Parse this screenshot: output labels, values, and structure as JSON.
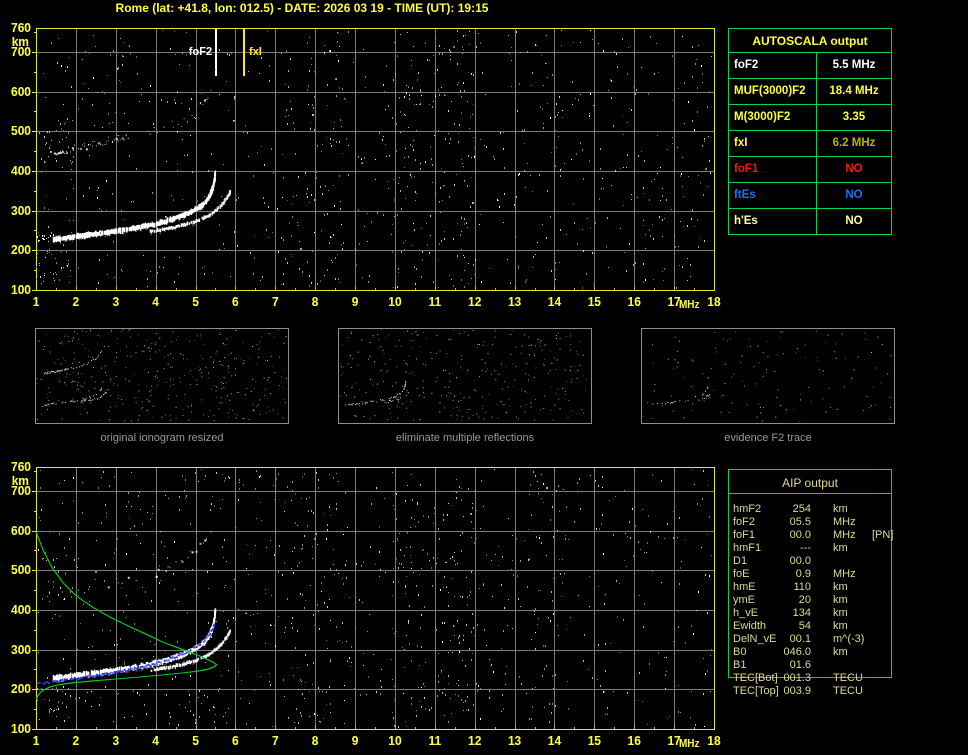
{
  "title": "Rome (lat: +41.8, lon: 012.5) - DATE: 2026 03 19 - TIME (UT): 19:15",
  "colors": {
    "background": "#000000",
    "title": "#ffff38",
    "axis_label": "#ffff38",
    "plot_border": "#e8e81c",
    "grid": "#7a7a7a",
    "table_border": "#00d455",
    "caption": "#9a9a9a",
    "thumbnail_border": "#8f8f8f",
    "aip_text": "#dadc8e",
    "trace_white": "#ffffff",
    "profile_green": "#00cc22",
    "restored_blue": "#2737e8",
    "fof2_marker": "#ffffff",
    "fxi_marker": "#ffee00"
  },
  "autoscala_table": {
    "header": "AUTOSCALA output",
    "rows": [
      {
        "label": "foF2",
        "value": "5.5 MHz",
        "label_color": "#ffffff",
        "value_color": "#ffffff"
      },
      {
        "label": "MUF(3000)F2",
        "value": "18.4 MHz",
        "label_color": "#ffff2e",
        "value_color": "#ffff2e"
      },
      {
        "label": "M(3000)F2",
        "value": "3.35",
        "label_color": "#ffff2e",
        "value_color": "#ffff2e"
      },
      {
        "label": "fxI",
        "value": "6.2 MHz",
        "label_color": "#ffff2e",
        "value_color": "#b9b400"
      },
      {
        "label": "foF1",
        "value": "NO",
        "label_color": "#ff1414",
        "value_color": "#ff1414"
      },
      {
        "label": "ftEs",
        "value": "NO",
        "label_color": "#1a6eff",
        "value_color": "#1a6eff"
      },
      {
        "label": "h'Es",
        "value": "NO",
        "label_color": "#ffffa0",
        "value_color": "#ffffa0"
      }
    ]
  },
  "aip_table": {
    "header": "AIP output",
    "rows": [
      {
        "label": "hmF2",
        "value": "254",
        "unit": "km",
        "extra": ""
      },
      {
        "label": "foF2",
        "value": "05.5",
        "unit": "MHz",
        "extra": ""
      },
      {
        "label": "foF1",
        "value": "00.0",
        "unit": "MHz",
        "extra": "[PN]"
      },
      {
        "label": "hmF1",
        "value": "---",
        "unit": "km",
        "extra": ""
      },
      {
        "label": "D1",
        "value": "00.0",
        "unit": "",
        "extra": ""
      },
      {
        "label": "foE",
        "value": "0.9",
        "unit": "MHz",
        "extra": ""
      },
      {
        "label": "hmE",
        "value": "110",
        "unit": "km",
        "extra": ""
      },
      {
        "label": "ymE",
        "value": "20",
        "unit": "km",
        "extra": ""
      },
      {
        "label": "h_vE",
        "value": "134",
        "unit": "km",
        "extra": ""
      },
      {
        "label": "Ewidth",
        "value": "54",
        "unit": "km",
        "extra": ""
      },
      {
        "label": "DelN_vE",
        "value": "00.1",
        "unit": "m^(-3)",
        "extra": ""
      },
      {
        "label": "B0",
        "value": "046.0",
        "unit": "km",
        "extra": ""
      },
      {
        "label": "B1",
        "value": "01.6",
        "unit": "",
        "extra": ""
      },
      {
        "label": "TEC[Bot]",
        "value": "001.3",
        "unit": "TECU",
        "extra": ""
      },
      {
        "label": "TEC[Top]",
        "value": "003.9",
        "unit": "TECU",
        "extra": ""
      }
    ]
  },
  "thumbnails": [
    {
      "caption": "original ionogram resized",
      "series": [
        {
          "ref": 0,
          "density": 0.6
        },
        {
          "ref": 1,
          "density": 0.5
        },
        {
          "ref": 2,
          "density": 0.45
        },
        {
          "ref": 3,
          "density": 0.8
        }
      ],
      "noise": 390
    },
    {
      "caption": "eliminate multiple reflections",
      "series": [
        {
          "ref": 0,
          "density": 0.55
        },
        {
          "ref": 1,
          "density": 0.45
        }
      ],
      "noise": 320
    },
    {
      "caption": "evidence F2 trace",
      "series": [
        {
          "ref": 0,
          "density": 0.5,
          "f0": 1.6,
          "f1": 5.45
        },
        {
          "ref": 1,
          "density": 0.3,
          "f0": 4.6,
          "f1": 5.86
        }
      ],
      "noise": 135
    }
  ],
  "chart_data": [
    {
      "type": "scatter",
      "name": "scaled ionogram with autoscaled characteristics",
      "xlabel": "MHz",
      "ylabel": "km",
      "xlim": [
        1,
        18
      ],
      "ylim": [
        100,
        760
      ],
      "x_ticks": [
        1,
        2,
        3,
        4,
        5,
        6,
        7,
        8,
        9,
        10,
        11,
        12,
        13,
        14,
        15,
        16,
        17,
        18
      ],
      "y_ticks": [
        760,
        700,
        600,
        500,
        400,
        300,
        200,
        100
      ],
      "grid": true,
      "markers": [
        {
          "label": "foF2",
          "freq": 5.5,
          "color": "#ffffff"
        },
        {
          "label": "fxI",
          "freq": 6.2,
          "color": "#ffee00"
        }
      ],
      "series": [
        {
          "name": "F2-trace-o-mode",
          "color": "#ffffff",
          "style": "band",
          "thickness": 5,
          "density": 0.93,
          "points": [
            [
              1.42,
              227
            ],
            [
              1.7,
              231
            ],
            [
              2.0,
              235
            ],
            [
              2.4,
              240
            ],
            [
              2.8,
              245
            ],
            [
              3.2,
              251
            ],
            [
              3.6,
              258
            ],
            [
              4.0,
              266
            ],
            [
              4.35,
              276
            ],
            [
              4.65,
              287
            ],
            [
              4.9,
              298
            ],
            [
              5.1,
              310
            ],
            [
              5.25,
              324
            ],
            [
              5.35,
              340
            ],
            [
              5.42,
              358
            ],
            [
              5.46,
              378
            ],
            [
              5.48,
              400
            ]
          ]
        },
        {
          "name": "F2-trace-x-mode",
          "color": "#f2f2f2",
          "style": "band",
          "thickness": 3,
          "density": 0.85,
          "points": [
            [
              3.85,
              247
            ],
            [
              4.15,
              252
            ],
            [
              4.45,
              258
            ],
            [
              4.75,
              265
            ],
            [
              5.0,
              273
            ],
            [
              5.25,
              284
            ],
            [
              5.45,
              297
            ],
            [
              5.6,
              310
            ],
            [
              5.72,
              325
            ],
            [
              5.82,
              340
            ],
            [
              5.86,
              348
            ]
          ]
        },
        {
          "name": "second-hop-trace",
          "color": "#c8c8c8",
          "style": "speckle",
          "thickness": 4,
          "density": 0.38,
          "points": [
            [
              1.3,
              440
            ],
            [
              1.6,
              450
            ],
            [
              1.95,
              459
            ],
            [
              2.3,
              467
            ],
            [
              2.65,
              474
            ],
            [
              3.0,
              481
            ],
            [
              3.35,
              489
            ],
            [
              3.7,
              498
            ],
            [
              4.05,
              508
            ],
            [
              4.35,
              518
            ],
            [
              4.65,
              532
            ],
            [
              4.9,
              548
            ],
            [
              5.1,
              563
            ],
            [
              5.25,
              580
            ],
            [
              5.35,
              597
            ],
            [
              5.43,
              612
            ]
          ]
        },
        {
          "name": "second-hop-core",
          "color": "#ffffff",
          "style": "speckle",
          "thickness": 3,
          "density": 0.85,
          "points": [
            [
              1.55,
              449
            ],
            [
              2.0,
              460
            ],
            [
              2.45,
              468
            ],
            [
              2.9,
              476
            ],
            [
              3.3,
              486
            ]
          ]
        }
      ],
      "noise": {
        "count": 700,
        "bands": [
          [
            7.2,
            8.8,
            60
          ],
          [
            9.9,
            12.2,
            150
          ],
          [
            15.8,
            17.9,
            40
          ]
        ],
        "clusters": [
          {
            "f": [
              1.0,
              1.9
            ],
            "km": [
              120,
              205
            ],
            "count": 30
          },
          {
            "f": [
              1.0,
              2.0
            ],
            "km": [
              395,
              530
            ],
            "count": 28
          },
          {
            "f": [
              1.0,
              1.45
            ],
            "km": [
              218,
              240
            ],
            "count": 16,
            "bright": 1
          }
        ]
      }
    },
    {
      "type": "scatter",
      "name": "ionogram with restored trace and electron density profile",
      "xlabel": "MHz",
      "ylabel": "km",
      "xlim": [
        1,
        18
      ],
      "ylim": [
        100,
        760
      ],
      "x_ticks": [
        1,
        2,
        3,
        4,
        5,
        6,
        7,
        8,
        9,
        10,
        11,
        12,
        13,
        14,
        15,
        16,
        17,
        18
      ],
      "y_ticks": [
        760,
        700,
        600,
        500,
        400,
        300,
        200,
        100
      ],
      "grid": true,
      "series": [
        {
          "name": "F2-trace-o-mode",
          "color": "#ffffff",
          "style": "band",
          "thickness": 5,
          "density": 0.93,
          "points": [
            [
              1.42,
              227
            ],
            [
              1.7,
              231
            ],
            [
              2.0,
              235
            ],
            [
              2.4,
              240
            ],
            [
              2.8,
              245
            ],
            [
              3.2,
              251
            ],
            [
              3.6,
              258
            ],
            [
              4.0,
              266
            ],
            [
              4.35,
              276
            ],
            [
              4.65,
              287
            ],
            [
              4.9,
              298
            ],
            [
              5.1,
              310
            ],
            [
              5.25,
              324
            ],
            [
              5.35,
              340
            ],
            [
              5.42,
              358
            ],
            [
              5.46,
              378
            ],
            [
              5.48,
              400
            ]
          ]
        },
        {
          "name": "F2-trace-x-mode",
          "color": "#f2f2f2",
          "style": "band",
          "thickness": 3,
          "density": 0.85,
          "points": [
            [
              3.85,
              247
            ],
            [
              4.15,
              252
            ],
            [
              4.45,
              258
            ],
            [
              4.75,
              265
            ],
            [
              5.0,
              273
            ],
            [
              5.25,
              284
            ],
            [
              5.45,
              297
            ],
            [
              5.6,
              310
            ],
            [
              5.72,
              325
            ],
            [
              5.82,
              340
            ],
            [
              5.86,
              348
            ]
          ]
        },
        {
          "name": "second-hop-trace",
          "color": "#cccccc",
          "style": "speckle",
          "thickness": 4,
          "density": 0.32,
          "points": [
            [
              1.9,
              447
            ],
            [
              2.3,
              455
            ],
            [
              2.7,
              462
            ],
            [
              3.1,
              469
            ],
            [
              3.5,
              478
            ],
            [
              3.9,
              490
            ],
            [
              4.25,
              505
            ],
            [
              4.6,
              524
            ],
            [
              4.9,
              545
            ],
            [
              5.15,
              565
            ],
            [
              5.3,
              582
            ],
            [
              5.42,
              597
            ]
          ]
        },
        {
          "name": "restored-trace",
          "color": "#2737e8",
          "style": "dots",
          "thickness": 2,
          "density": 0.95,
          "points": [
            [
              1.02,
              217
            ],
            [
              1.3,
              220
            ],
            [
              1.6,
              224
            ],
            [
              1.95,
              229
            ],
            [
              2.35,
              235
            ],
            [
              2.8,
              242
            ],
            [
              3.25,
              250
            ],
            [
              3.7,
              260
            ],
            [
              4.1,
              271
            ],
            [
              4.45,
              283
            ],
            [
              4.75,
              296
            ],
            [
              5.0,
              309
            ],
            [
              5.18,
              323
            ],
            [
              5.32,
              339
            ],
            [
              5.42,
              356
            ],
            [
              5.46,
              368
            ]
          ]
        },
        {
          "name": "electron-density-profile",
          "color": "#00cc22",
          "style": "line",
          "thickness": 1.2,
          "points": [
            [
              1.0,
              597
            ],
            [
              1.18,
              550
            ],
            [
              1.4,
              507
            ],
            [
              1.68,
              468
            ],
            [
              2.0,
              436
            ],
            [
              2.4,
              408
            ],
            [
              2.85,
              382
            ],
            [
              3.3,
              360
            ],
            [
              3.8,
              337
            ],
            [
              4.2,
              318
            ],
            [
              4.6,
              303
            ],
            [
              4.9,
              292
            ],
            [
              5.15,
              282
            ],
            [
              5.32,
              274
            ],
            [
              5.44,
              268
            ],
            [
              5.53,
              262
            ],
            [
              5.47,
              257
            ],
            [
              5.32,
              251
            ],
            [
              5.05,
              246
            ],
            [
              4.65,
              241
            ],
            [
              4.15,
              236
            ],
            [
              3.6,
              231
            ],
            [
              3.0,
              226
            ],
            [
              2.45,
              221
            ],
            [
              1.95,
              217
            ],
            [
              1.6,
              212
            ],
            [
              1.35,
              206
            ],
            [
              1.2,
              199
            ],
            [
              1.1,
              191
            ],
            [
              1.04,
              183
            ],
            [
              1.0,
              173
            ]
          ]
        }
      ],
      "noise": {
        "count": 700,
        "bands": [
          [
            7.2,
            8.8,
            80
          ],
          [
            9.9,
            12.2,
            160
          ],
          [
            13.3,
            14.3,
            40
          ]
        ],
        "clusters": [
          {
            "f": [
              1.0,
              1.9
            ],
            "km": [
              120,
              205
            ],
            "count": 25
          },
          {
            "f": [
              1.05,
              2.1
            ],
            "km": [
              420,
              530
            ],
            "count": 22
          },
          {
            "f": [
              4.3,
              5.8
            ],
            "km": [
              110,
              200
            ],
            "count": 25
          }
        ]
      }
    }
  ]
}
